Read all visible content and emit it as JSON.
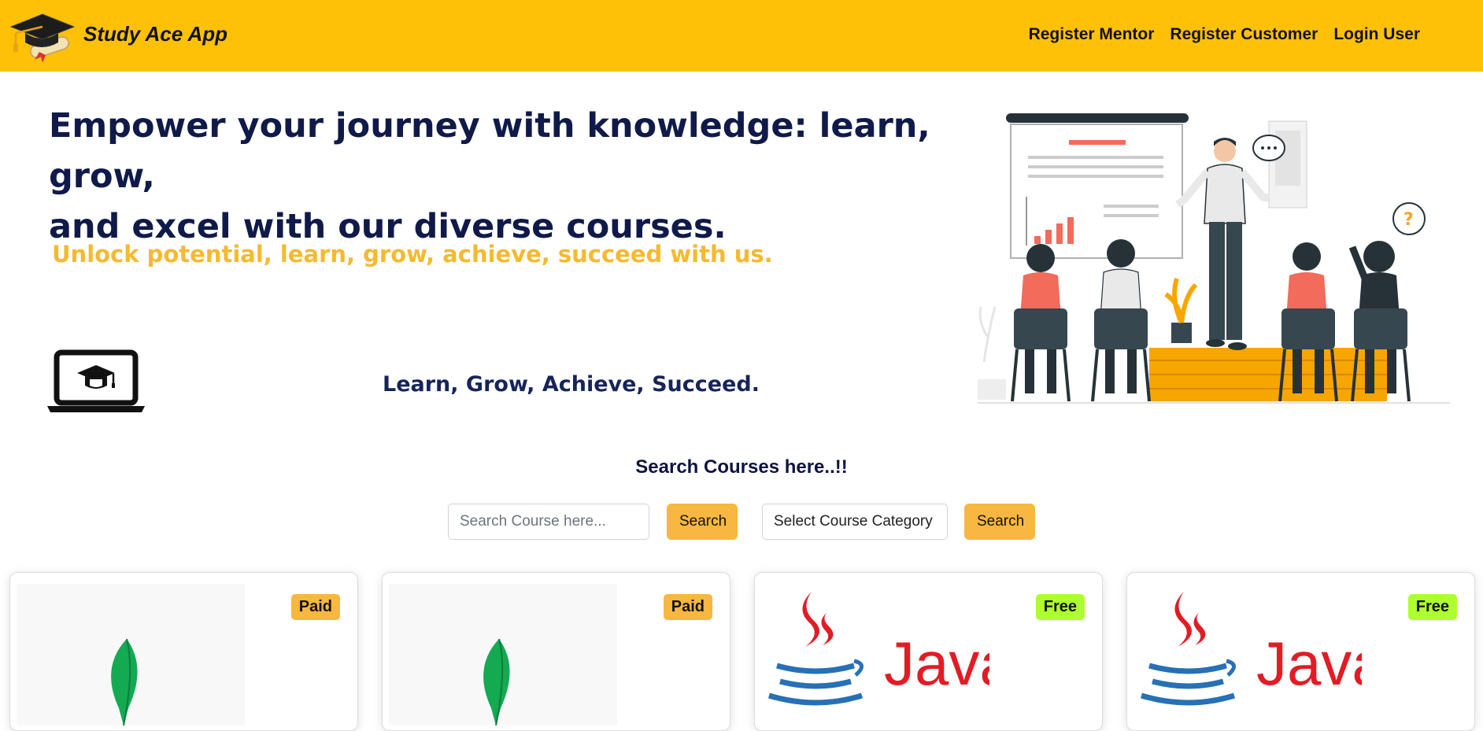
{
  "header": {
    "brand_title": "Study Ace App",
    "nav": [
      "Register Mentor",
      "Register Customer",
      "Login User"
    ]
  },
  "hero": {
    "heading_line1": "Empower your journey with knowledge: learn, grow,",
    "heading_line2": "and excel with our diverse courses.",
    "subheading": "Unlock potential, learn, grow, achieve, succeed with us.",
    "tagline": "Learn, Grow, Achieve, Succeed."
  },
  "search": {
    "title": "Search Courses here..!!",
    "input_placeholder": "Search Course here...",
    "button_label": "Search",
    "category_placeholder": "Select Course Category",
    "category_button_label": "Search"
  },
  "courses": [
    {
      "badge": "Paid",
      "image": "mongodb-leaf"
    },
    {
      "badge": "Paid",
      "image": "mongodb-leaf"
    },
    {
      "badge": "Free",
      "image": "java-logo",
      "logo_text": "Java"
    },
    {
      "badge": "Free",
      "image": "java-logo",
      "logo_text": "Java"
    }
  ],
  "colors": {
    "navbar": "#ffc107",
    "accent_button": "#f8b740",
    "badge_paid": "#f8b740",
    "badge_free": "#adff2f",
    "heading": "#101a4a",
    "subheading": "#f6b92f"
  },
  "icons": {
    "brand": "graduation-cap-icon",
    "laptop": "laptop-graduation-icon"
  }
}
